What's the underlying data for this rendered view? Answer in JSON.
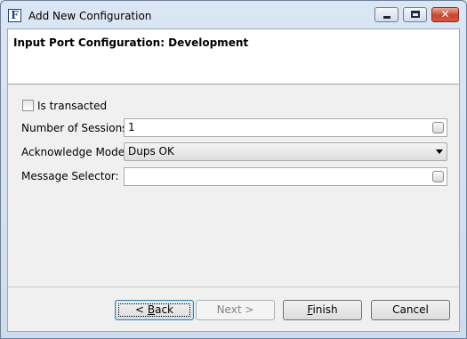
{
  "window": {
    "title": "Add New Configuration",
    "app_icon_letter": "F",
    "close_glyph": "✕"
  },
  "header": {
    "title": "Input Port Configuration: Development"
  },
  "form": {
    "is_transacted": {
      "label": "Is transacted",
      "checked": false
    },
    "sessions": {
      "label": "Number of Sessions:",
      "value": "1"
    },
    "ack_mode": {
      "label": "Acknowledge Mode:",
      "value": "Dups OK"
    },
    "selector": {
      "label": "Message Selector:",
      "value": ""
    }
  },
  "buttons": {
    "back": {
      "prefix": "< ",
      "accel": "B",
      "rest": "ack"
    },
    "next": {
      "label": "Next >"
    },
    "finish": {
      "accel": "F",
      "rest": "inish"
    },
    "cancel": {
      "label": "Cancel"
    }
  }
}
